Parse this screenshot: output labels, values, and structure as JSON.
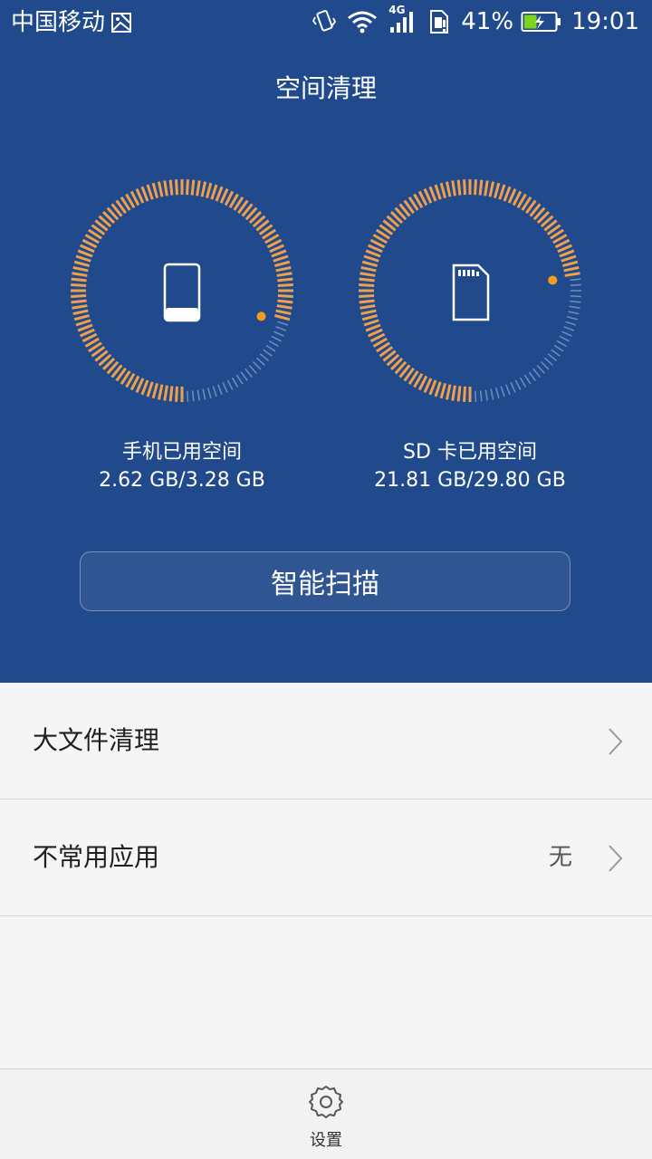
{
  "status_bar": {
    "carrier": "中国移动",
    "network_type": "4G",
    "battery_percent": "41%",
    "battery_level": 0.41,
    "time": "19:01",
    "icons": [
      "image-notification-icon",
      "vibrate-icon",
      "wifi-icon",
      "signal-icon",
      "sim-alert-icon",
      "battery-charging-icon"
    ]
  },
  "header": {
    "title": "空间清理"
  },
  "storage": {
    "phone": {
      "label": "手机已用空间",
      "value": "2.62 GB/3.28 GB",
      "used_fraction": 0.8,
      "icon": "phone-icon"
    },
    "sd": {
      "label": "SD 卡已用空间",
      "value": "21.81 GB/29.80 GB",
      "used_fraction": 0.73,
      "icon": "sd-card-icon"
    }
  },
  "scan_button": {
    "label": "智能扫描"
  },
  "list": [
    {
      "label": "大文件清理",
      "value": ""
    },
    {
      "label": "不常用应用",
      "value": "无"
    }
  ],
  "bottom_bar": {
    "settings_label": "设置"
  },
  "colors": {
    "header_bg": "#204a8b",
    "used_tick": "#f0a04b",
    "unused_tick": "#6f8fc0",
    "marker_dot": "#f39c1f"
  }
}
